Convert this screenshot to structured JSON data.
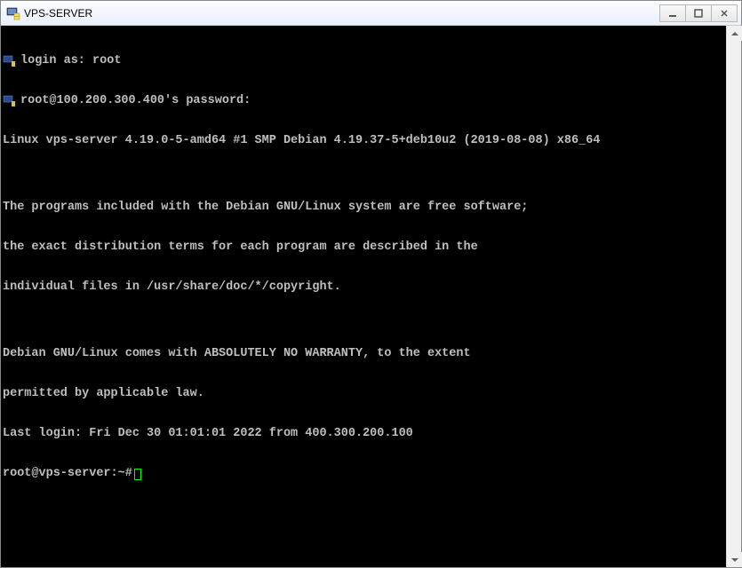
{
  "titlebar": {
    "title": "VPS-SERVER"
  },
  "terminal": {
    "login_prompt": "login as: root",
    "password_prompt": "root@100.200.300.400's password:",
    "lines": [
      "Linux vps-server 4.19.0-5-amd64 #1 SMP Debian 4.19.37-5+deb10u2 (2019-08-08) x86_64",
      "",
      "The programs included with the Debian GNU/Linux system are free software;",
      "the exact distribution terms for each program are described in the",
      "individual files in /usr/share/doc/*/copyright.",
      "",
      "Debian GNU/Linux comes with ABSOLUTELY NO WARRANTY, to the extent",
      "permitted by applicable law.",
      "Last login: Fri Dec 30 01:01:01 2022 from 400.300.200.100"
    ],
    "prompt": "root@vps-server:~#"
  }
}
